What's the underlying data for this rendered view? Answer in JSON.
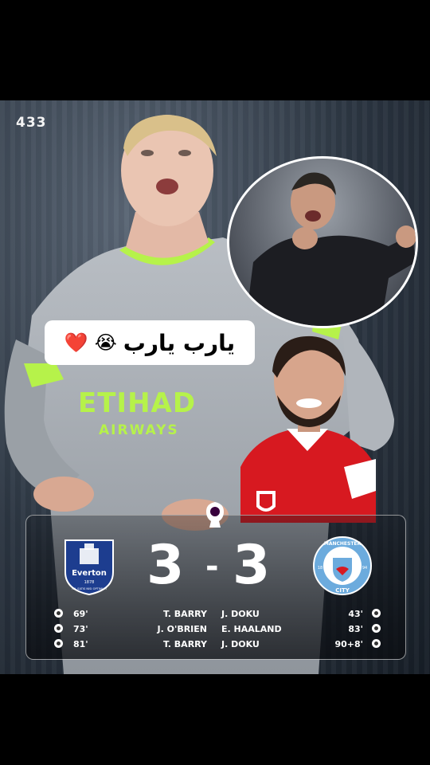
{
  "brand": "433",
  "caption": {
    "text": "يارب يارب",
    "emoji_cry": "😭",
    "emoji_heart": "❤️"
  },
  "shirt": {
    "sponsor": "ETIHAD",
    "sponsor_sub": "AIRWAYS"
  },
  "match": {
    "home": {
      "name": "Everton",
      "crest_text": "Everton",
      "crest_year": "1878",
      "crest_motto": "NIL SATIS NISI OPTIMUM",
      "score": "3"
    },
    "away": {
      "name": "Manchester City",
      "crest_top": "MANCHESTER",
      "crest_bottom": "CITY",
      "crest_y1": "18",
      "crest_y2": "94",
      "score": "3"
    },
    "separator": "-",
    "goals": [
      {
        "home_min": "69'",
        "home_scorer": "T. BARRY",
        "away_scorer": "J. DOKU",
        "away_min": "43'"
      },
      {
        "home_min": "73'",
        "home_scorer": "J. O'BRIEN",
        "away_scorer": "E. HAALAND",
        "away_min": "83'"
      },
      {
        "home_min": "81'",
        "home_scorer": "T. BARRY",
        "away_scorer": "J. DOKU",
        "away_min": "90+8'"
      }
    ]
  },
  "colors": {
    "accent_green": "#b6f24a",
    "everton_blue": "#1d3d8f",
    "city_blue": "#6cabdd",
    "arsenal_red": "#d71920"
  }
}
